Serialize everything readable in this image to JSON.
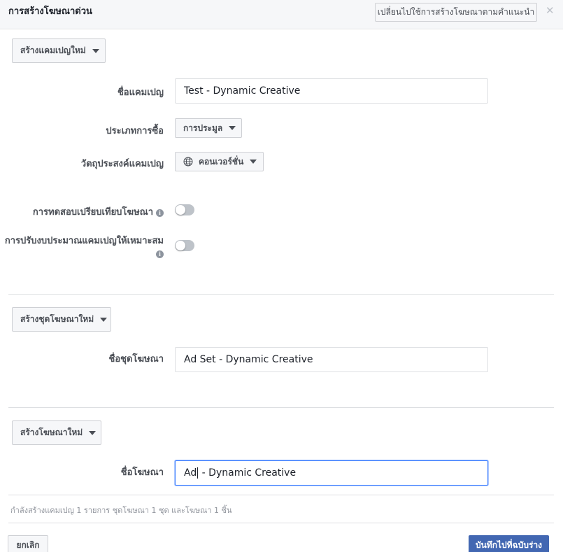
{
  "header": {
    "title": "การสร้างโฆษณาด่วน",
    "switch_label": "เปลี่ยนไปใช้การสร้างโฆษณาตามคำแนะนำ",
    "close_glyph": "✕"
  },
  "campaign": {
    "create_label": "สร้างแคมเปญใหม่",
    "name_label": "ชื่อแคมเปญ",
    "name_value": "Test - Dynamic Creative",
    "buying_type_label": "ประเภทการซื้อ",
    "buying_type_value": "การประมูล",
    "objective_label": "วัตถุประสงค์แคมเปญ",
    "objective_value": "คอนเวอร์ชั่น",
    "split_test_label": "การทดสอบเปรียบเทียบโฆษณา",
    "budget_opt_label": "การปรับงบประมาณแคมเปญให้เหมาะสม",
    "info_glyph": "i"
  },
  "adset": {
    "create_label": "สร้างชุดโฆษณาใหม่",
    "name_label": "ชื่อชุดโฆษณา",
    "name_value": "Ad Set - Dynamic Creative"
  },
  "ad": {
    "create_label": "สร้างโฆษณาใหม่",
    "name_label": "ชื่อโฆษณา",
    "name_value_before_cursor": "Ad",
    "name_value_after_cursor": " - Dynamic Creative"
  },
  "footer": {
    "status": "กำลังสร้างแคมเปญ 1 รายการ ชุดโฆษณา 1 ชุด และโฆษณา 1 ชิ้น",
    "cancel_label": "ยกเลิก",
    "save_label": "บันทึกไปที่ฉบับร่าง"
  },
  "colors": {
    "primary": "#4267b2",
    "focus": "#4080ff",
    "toggle_off": "#bec3c9"
  }
}
